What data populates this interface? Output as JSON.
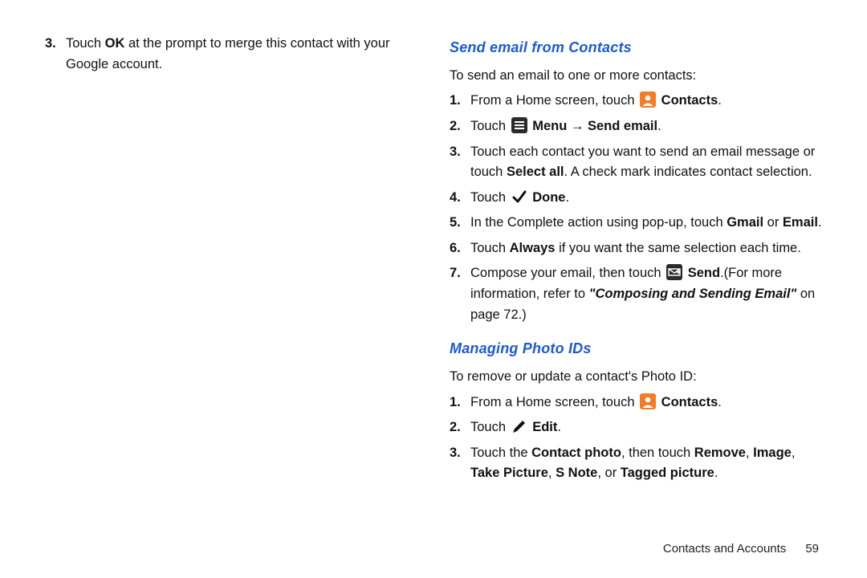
{
  "left": {
    "step3": {
      "num": "3.",
      "pre": "Touch ",
      "ok": "OK",
      "post": " at the prompt to merge this contact with your Google account."
    }
  },
  "right": {
    "section_email_title": "Send email from Contacts",
    "email_intro": "To send an email to one or more contacts:",
    "email_steps": {
      "s1": {
        "num": "1.",
        "pre": "From a Home screen, touch ",
        "contacts": "Contacts",
        "post": "."
      },
      "s2": {
        "num": "2.",
        "touch": "Touch ",
        "menu": "Menu",
        "arrow": " → ",
        "sendemail": "Send email",
        "post": "."
      },
      "s3": {
        "num": "3.",
        "pre": "Touch each contact you want to send an email message or touch ",
        "selectall": "Select all",
        "post": ". A check mark indicates contact selection."
      },
      "s4": {
        "num": "4.",
        "touch": "Touch ",
        "done": "Done",
        "post": "."
      },
      "s5": {
        "num": "5.",
        "pre": "In the Complete action using pop-up, touch ",
        "gmail": "Gmail",
        "or": " or ",
        "email": "Email",
        "post": "."
      },
      "s6": {
        "num": "6.",
        "pre": "Touch ",
        "always": "Always",
        "post": " if you want the same selection each time."
      },
      "s7": {
        "num": "7.",
        "pre": "Compose your email, then touch ",
        "send": "Send",
        "mid": ".(For more information, refer to ",
        "ref": "\"Composing and Sending Email\"",
        "on": " on page 72.)"
      }
    },
    "section_photo_title": "Managing Photo IDs",
    "photo_intro": "To remove or update a contact's Photo ID:",
    "photo_steps": {
      "s1": {
        "num": "1.",
        "pre": "From a Home screen, touch ",
        "contacts": "Contacts",
        "post": "."
      },
      "s2": {
        "num": "2.",
        "touch": "Touch ",
        "edit": "Edit",
        "post": "."
      },
      "s3": {
        "num": "3.",
        "pre": "Touch the ",
        "contactphoto": "Contact photo",
        "then": ", then touch ",
        "remove": "Remove",
        "c1": ", ",
        "image": "Image",
        "c2": ", ",
        "takepic": "Take Picture",
        "c3": ", ",
        "snote": "S Note",
        "or": ", or ",
        "tagged": "Tagged picture",
        "post": "."
      }
    }
  },
  "footer": {
    "text": "Contacts and Accounts",
    "page": "59"
  }
}
